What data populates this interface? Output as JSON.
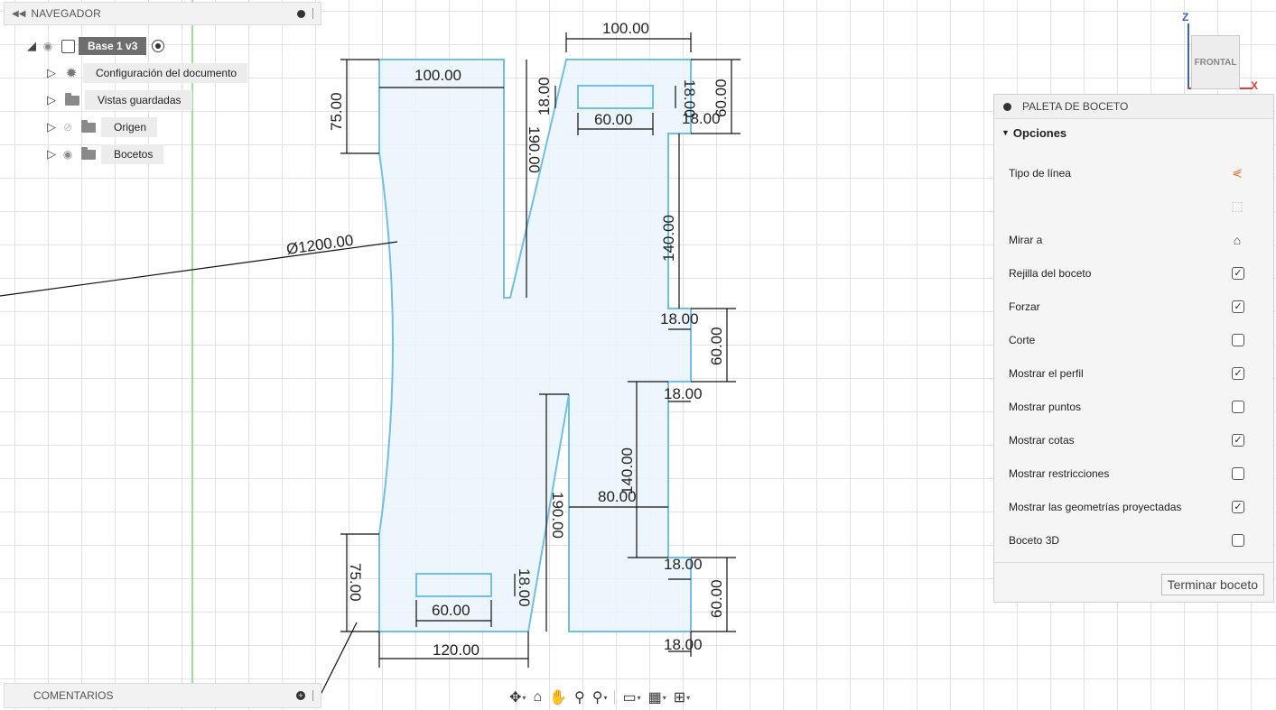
{
  "navigator": {
    "title": "NAVEGADOR",
    "root_label": "Base 1 v3",
    "items": [
      {
        "label": "Configuración del documento",
        "icon": "gear-icon"
      },
      {
        "label": "Vistas guardadas",
        "icon": "folder-icon"
      },
      {
        "label": "Origen",
        "icon": "folder-icon",
        "visibility": "hidden"
      },
      {
        "label": "Bocetos",
        "icon": "folder-icon",
        "visibility": "visible"
      }
    ]
  },
  "comments": {
    "title": "COMENTARIOS"
  },
  "viewcube": {
    "face_label": "FRONTAL",
    "axis_z": "Z",
    "axis_x": "X"
  },
  "palette": {
    "title": "PALETA DE BOCETO",
    "section_label": "Opciones",
    "rows": [
      {
        "label": "Tipo de línea",
        "kind": "icon",
        "icon": "linetype-icon"
      },
      {
        "label": "",
        "kind": "icon",
        "icon": "construction-icon"
      },
      {
        "label": "Mirar a",
        "kind": "icon",
        "icon": "look-at-icon"
      },
      {
        "label": "Rejilla del boceto",
        "kind": "checkbox",
        "checked": true
      },
      {
        "label": "Forzar",
        "kind": "checkbox",
        "checked": true
      },
      {
        "label": "Corte",
        "kind": "checkbox",
        "checked": false
      },
      {
        "label": "Mostrar el perfil",
        "kind": "checkbox",
        "checked": true
      },
      {
        "label": "Mostrar puntos",
        "kind": "checkbox",
        "checked": false
      },
      {
        "label": "Mostrar cotas",
        "kind": "checkbox",
        "checked": true
      },
      {
        "label": "Mostrar restricciones",
        "kind": "checkbox",
        "checked": false
      },
      {
        "label": "Mostrar las geometrías proyectadas",
        "kind": "checkbox",
        "checked": true
      },
      {
        "label": "Boceto 3D",
        "kind": "checkbox",
        "checked": false
      }
    ],
    "finish_label": "Terminar boceto"
  },
  "dimensions": {
    "top_left_width": "100.00",
    "top_right_width": "100.00",
    "left_top_height": "75.00",
    "diameter": "Ø1200.00",
    "slot_top_width": "60.00",
    "slot_top_height": "18.00",
    "slot_top_offset": "18.00",
    "slot_top_side": "18.00",
    "right_top_height": "60.00",
    "slit_top_height": "190.00",
    "right_mid_height": "140.00",
    "notch1_depth": "18.00",
    "right_notch_height": "60.00",
    "notch2_depth": "18.00",
    "lower_mid_height": "140.00",
    "slit_bottom_height": "190.00",
    "inner_width": "80.00",
    "notch3_depth": "18.00",
    "right_bottom_height": "60.00",
    "notch4_depth": "18.00",
    "left_bottom_height": "75.00",
    "slot_bottom_width": "60.00",
    "slot_bottom_height": "18.00",
    "bottom_width": "120.00"
  },
  "toolbar": {
    "buttons": [
      "orbit-icon",
      "look-at-icon",
      "pan-icon",
      "zoom-icon",
      "zoom-window-icon",
      "display-icon",
      "grid-icon",
      "viewports-icon"
    ]
  }
}
